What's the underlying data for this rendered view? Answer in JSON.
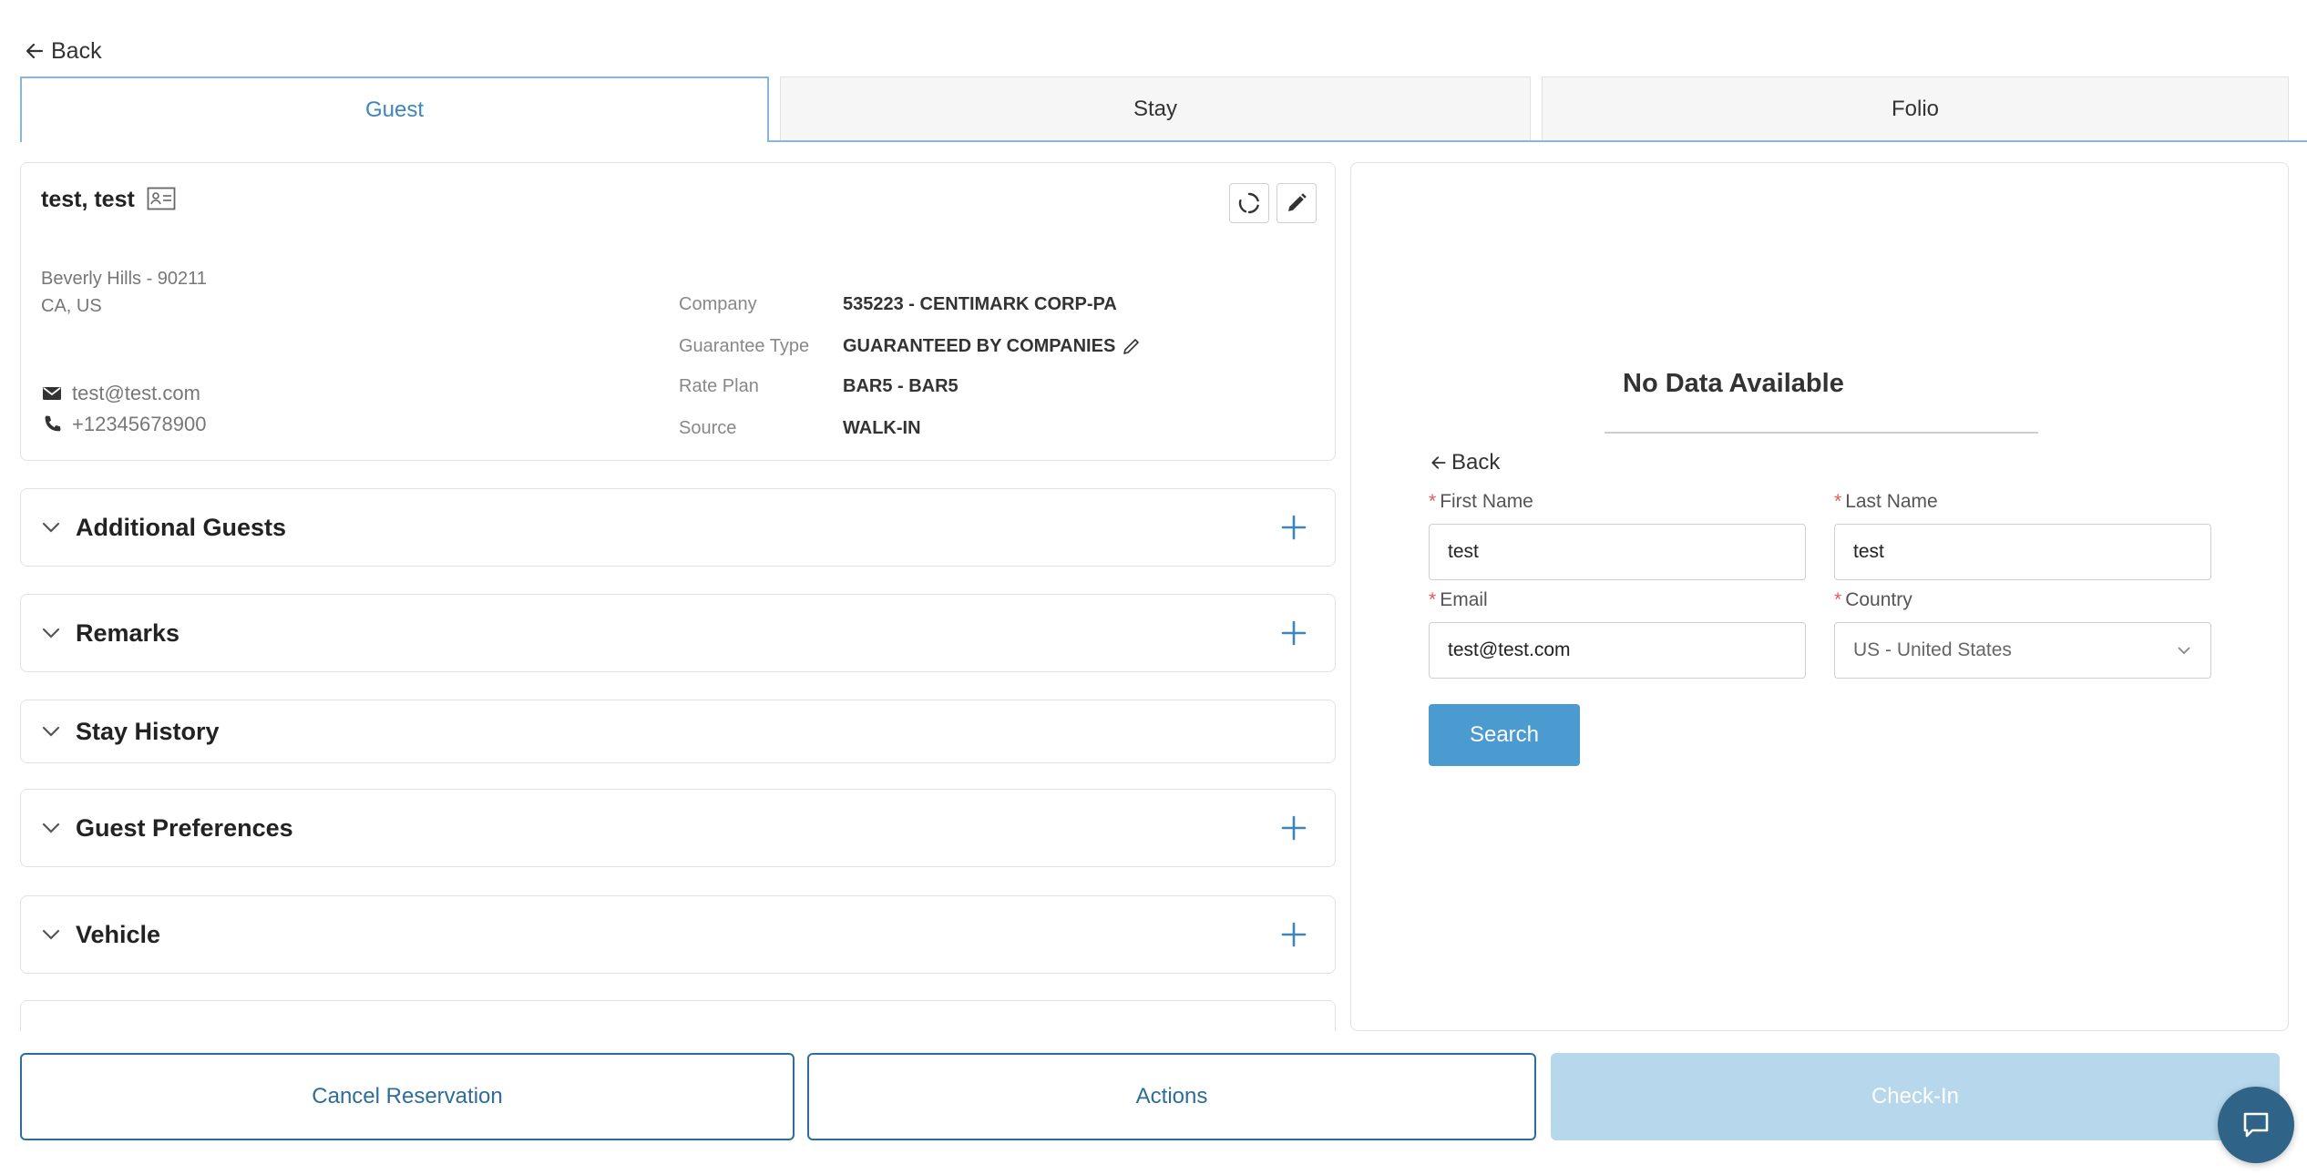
{
  "nav": {
    "back_label": "Back"
  },
  "tabs": [
    {
      "label": "Guest",
      "active": true
    },
    {
      "label": "Stay",
      "active": false
    },
    {
      "label": "Folio",
      "active": false
    }
  ],
  "guest": {
    "name": "test, test",
    "address_line1": "Beverly Hills  - 90211",
    "address_line2": "CA, US",
    "email": "test@test.com",
    "phone": "+12345678900",
    "details": [
      {
        "label": "Company",
        "value": "535223 - CENTIMARK CORP-PA"
      },
      {
        "label": "Guarantee Type",
        "value": "GUARANTEED BY COMPANIES"
      },
      {
        "label": "Rate Plan",
        "value": "BAR5 - BAR5"
      },
      {
        "label": "Source",
        "value": "WALK-IN"
      }
    ]
  },
  "sections": [
    {
      "title": "Additional Guests",
      "has_add": true
    },
    {
      "title": "Remarks",
      "has_add": true
    },
    {
      "title": "Stay History",
      "has_add": false
    },
    {
      "title": "Guest Preferences",
      "has_add": true
    },
    {
      "title": "Vehicle",
      "has_add": true
    }
  ],
  "search_panel": {
    "no_data_text": "No Data Available",
    "back_label": "Back",
    "first_name": {
      "label": "First Name",
      "value": "test"
    },
    "last_name": {
      "label": "Last Name",
      "value": "test"
    },
    "email": {
      "label": "Email",
      "value": "test@test.com"
    },
    "country": {
      "label": "Country",
      "value": "US - United States"
    },
    "search_label": "Search"
  },
  "footer": {
    "cancel_label": "Cancel Reservation",
    "actions_label": "Actions",
    "checkin_label": "Check-In"
  },
  "colors": {
    "accent": "#3f86b8",
    "primary_button": "#4b9ad0",
    "footer_border": "#2d6d9a",
    "disabled_button": "#b7d8ec",
    "chat_button": "#2f6388"
  }
}
